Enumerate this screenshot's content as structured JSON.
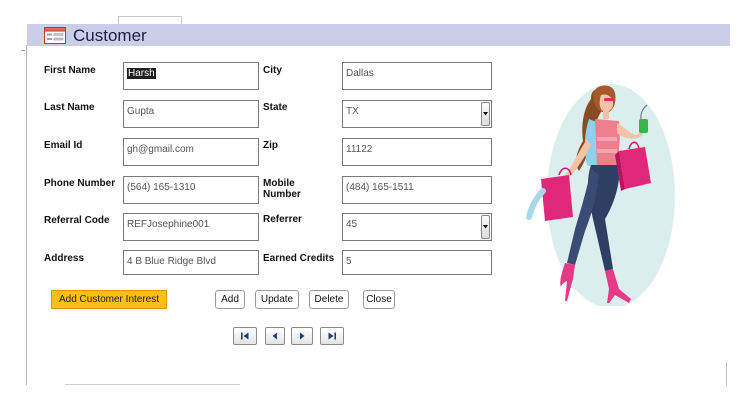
{
  "form": {
    "title": "Customer",
    "icon": "form-icon"
  },
  "fields": {
    "first_name": {
      "label": "First Name",
      "value": "Harsh"
    },
    "last_name": {
      "label": "Last Name",
      "value": "Gupta"
    },
    "email": {
      "label": "Email Id",
      "value": "gh@gmail.com"
    },
    "phone": {
      "label": "Phone Number",
      "value": "(564) 165-1310"
    },
    "referral_code": {
      "label": "Referral Code",
      "value": "REFJosephine001"
    },
    "address": {
      "label": "Address",
      "value": "4 B Blue Ridge Blvd"
    },
    "city": {
      "label": "City",
      "value": "Dallas"
    },
    "state": {
      "label": "State",
      "value": "TX"
    },
    "zip": {
      "label": "Zip",
      "value": "11122"
    },
    "mobile": {
      "label_line1": "Mobile",
      "label_line2": "Number",
      "value": "(484) 165-1511"
    },
    "referrer": {
      "label": "Referrer",
      "value": "45"
    },
    "earned_credits": {
      "label": "Earned Credits",
      "value": "5"
    }
  },
  "buttons": {
    "add_interest": "Add Customer Interest",
    "add": "Add",
    "update": "Update",
    "delete": "Delete",
    "close": "Close"
  },
  "navigation": {
    "icons": [
      "first-record-icon",
      "previous-record-icon",
      "next-record-icon",
      "last-record-icon"
    ]
  },
  "colors": {
    "header_band": "#cccde9",
    "interest_button": "#fcbe17"
  }
}
